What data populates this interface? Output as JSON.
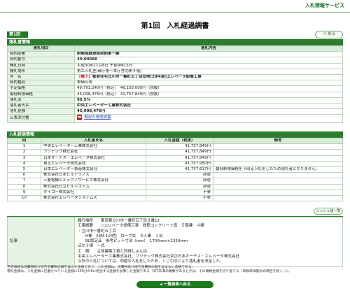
{
  "header": {
    "service_link": "入札情報サービス",
    "page_title": "第1回　入札経過調書",
    "round_tab": "第1回",
    "back_button": "＜ 戻る"
  },
  "info": {
    "section_title": "落札者情報",
    "col_item": "落札項目",
    "col_content": "落札内容",
    "rows": [
      {
        "label": "契約部署",
        "value": "財務局経理部契約第一課"
      },
      {
        "label": "契約番号",
        "value": "30-00580"
      },
      {
        "label": "開札日時",
        "value": "平成30年11月8日 午前9時15分"
      },
      {
        "label": "開札場所",
        "value": "第二入札室(都庁第一本庁舎北側４階)"
      },
      {
        "label": "件　名",
        "tag": "【電子】",
        "value": "都営住宅立川市一番町五丁目団地(28年度)エレベータ設備工事"
      },
      {
        "label": "契約種別",
        "value": "単価公表"
      },
      {
        "label": "予定価格",
        "value": "49,791,240円（税込）　46,103,000円（税抜）"
      },
      {
        "label": "最低制限価格",
        "value": "45,098,476円（税込）　41,757,849円（税抜）"
      },
      {
        "label": "落札率",
        "value": "90.5%"
      },
      {
        "label": "落札者氏名",
        "value": "中央エレベーター工業株式会社"
      },
      {
        "label": "落札金額",
        "value": "45,098,476円"
      },
      {
        "label": "公表添付書",
        "pdf": "現況の現地調書"
      }
    ]
  },
  "bids": {
    "section_title": "入札経過情報",
    "headers": [
      "回",
      "入札者氏名",
      "入札金額（税抜）",
      "備考"
    ],
    "rows": [
      {
        "no": "1",
        "name": "中央エレベーター工業株式会社",
        "amount": "41,757,849円",
        "note": ""
      },
      {
        "no": "2",
        "name": "フジテック株式会社",
        "amount": "41,757,849円",
        "note": ""
      },
      {
        "no": "3",
        "name": "日本オーチス・エレベータ株式会社",
        "amount": "41,757,849円",
        "note": ""
      },
      {
        "no": "4",
        "name": "東芝エレベータ株式会社",
        "amount": "41,757,950円",
        "note": ""
      },
      {
        "no": "5",
        "name": "日本エレベーター製造株式会社",
        "amount": "41,757,617円",
        "note": "最低制限価格を下回る入札をしたため落札者となりません。"
      },
      {
        "no": "6",
        "name": "株式会社日本ビルテクノス",
        "amount": "辞退",
        "note": ""
      },
      {
        "no": "7",
        "name": "三菱電機ビルテクノサービス株式会社",
        "amount": "辞退",
        "note": ""
      },
      {
        "no": "8",
        "name": "株式会社日立ビルシステム",
        "amount": "辞退",
        "note": ""
      },
      {
        "no": "9",
        "name": "ダイコー株式会社",
        "amount": "不参",
        "note": ""
      },
      {
        "no": "10",
        "name": "株式会社エレベータシステムズ",
        "amount": "不参",
        "note": ""
      }
    ],
    "history_button": "ハッシュ値一覧"
  },
  "notes": {
    "label": "記事",
    "lines": [
      "履行場所　　東京都立川市一番町五丁目８番12",
      "工事概要　　○エレベータ設備工事　鉄筋コンクリート造　５階建　４棟",
      "・立川市一番町五丁目",
      "　　H棟　28M-104型　ロープ式　９人乗　１台",
      "　　BL認定品　参考ピット寸法（mm）　1700ｍｍ×2350ｍｍ",
      "ほか３棟　一式",
      "工　期　　主体建築工事と同時しゅん功",
      "中央エレベーター工業株式会社、フジテック株式会社及び日本オーチス・エレベータ株式会社",
      "以外の入札については、同値の入札をしたため、くじ引きにより落札者を決定した。"
    ]
  },
  "footnotes": [
    "予定価格は消費税及び地方消費税の額を含んだ金額であり、入札金額は、消費税及び地方消費税の額を含まない金額である。",
    "落札金額は、入札金額に記載されている金額に100分の8に相当する金額を加算した金額である（1円未満の端数があるときは、その端数金額を切り捨てる（単数単価契約の場合を除く。））。"
  ],
  "bottom_button": "◄ 一覧画面へ戻る"
}
